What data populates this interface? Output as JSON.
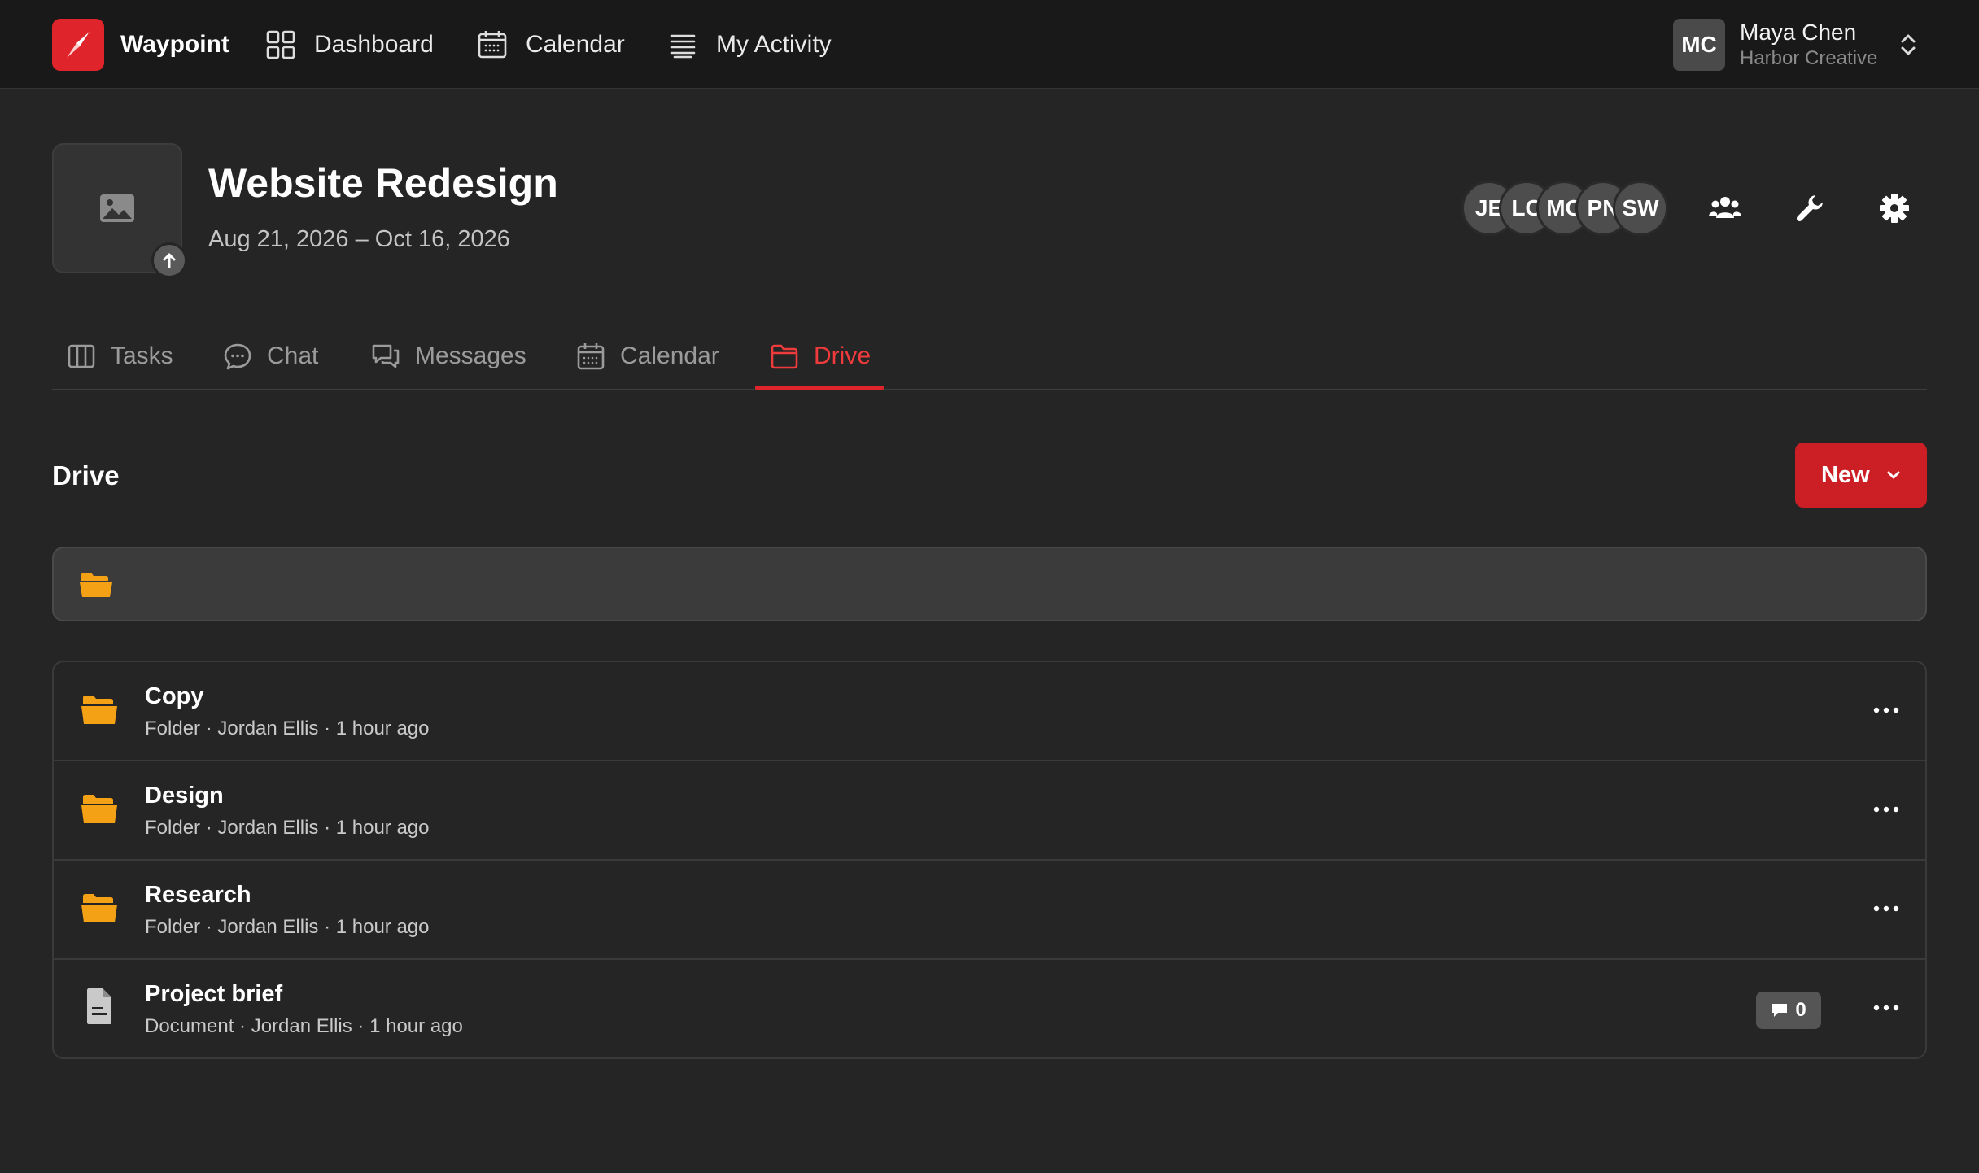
{
  "app": {
    "name": "Waypoint",
    "brand_color": "#e0242b"
  },
  "nav": {
    "items": [
      {
        "label": "Dashboard",
        "icon": "grid-icon"
      },
      {
        "label": "Calendar",
        "icon": "calendar-icon"
      },
      {
        "label": "My Activity",
        "icon": "activity-list-icon"
      }
    ]
  },
  "user": {
    "initials": "MC",
    "name": "Maya Chen",
    "org": "Harbor Creative"
  },
  "project": {
    "title": "Website Redesign",
    "dates": "Aug 21, 2026 – Oct 16, 2026",
    "members": [
      "JE",
      "LC",
      "MC",
      "PN",
      "SW"
    ]
  },
  "tabs": [
    {
      "label": "Tasks",
      "icon": "columns-icon",
      "active": false
    },
    {
      "label": "Chat",
      "icon": "chat-bubble-icon",
      "active": false
    },
    {
      "label": "Messages",
      "icon": "messages-icon",
      "active": false
    },
    {
      "label": "Calendar",
      "icon": "calendar-icon",
      "active": false
    },
    {
      "label": "Drive",
      "icon": "folder-icon",
      "active": true
    }
  ],
  "drive": {
    "title": "Drive",
    "new_label": "New",
    "accent_color": "#cc1f25",
    "folder_color": "#f5a115",
    "files": [
      {
        "name": "Copy",
        "type": "Folder",
        "owner": "Jordan Ellis",
        "time": "1 hour ago",
        "meta": "Folder · Jordan Ellis · 1 hour ago"
      },
      {
        "name": "Design",
        "type": "Folder",
        "owner": "Jordan Ellis",
        "time": "1 hour ago",
        "meta": "Folder · Jordan Ellis · 1 hour ago"
      },
      {
        "name": "Research",
        "type": "Folder",
        "owner": "Jordan Ellis",
        "time": "1 hour ago",
        "meta": "Folder · Jordan Ellis · 1 hour ago"
      },
      {
        "name": "Project brief",
        "type": "Document",
        "owner": "Jordan Ellis",
        "time": "1 hour ago",
        "meta": "Document · Jordan Ellis · 1 hour ago",
        "comments": "0"
      }
    ]
  }
}
